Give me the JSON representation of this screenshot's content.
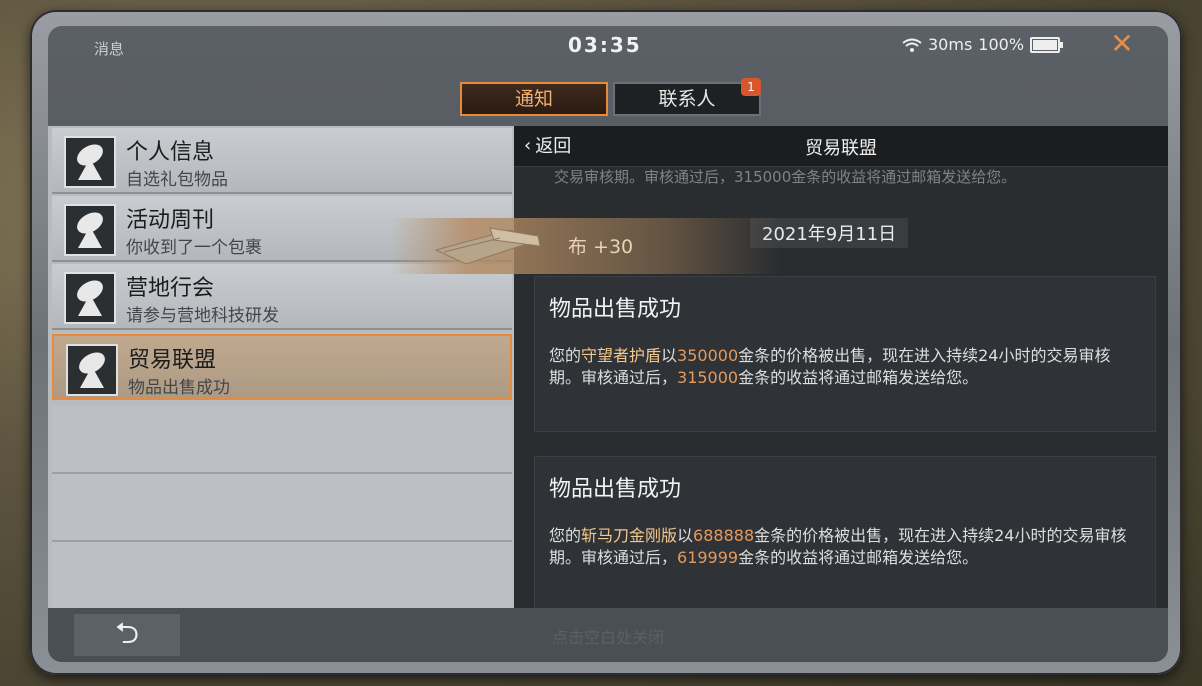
{
  "status": {
    "title": "消息",
    "clock": "03:35",
    "ping": "30ms",
    "battery": "100%"
  },
  "tabs": [
    {
      "label": "通知",
      "active": true
    },
    {
      "label": "联系人",
      "badge": "1"
    }
  ],
  "list": [
    {
      "name": "个人信息",
      "sub": "自选礼包物品"
    },
    {
      "name": "活动周刊",
      "sub": "你收到了一个包裹"
    },
    {
      "name": "营地行会",
      "sub": "请参与营地科技研发"
    },
    {
      "name": "贸易联盟",
      "sub": "物品出售成功",
      "selected": true
    }
  ],
  "panel": {
    "back_label": "返回",
    "title": "贸易联盟",
    "cut_text": "交易审核期。审核通过后，315000金条的收益将通过邮箱发送给您。",
    "date": "2021年9月11日",
    "messages": [
      {
        "title": "物品出售成功",
        "pre": "您的",
        "item": "守望者护盾",
        "mid1": "以",
        "price": "350000",
        "mid2": "金条的价格被出售，现在进入持续24小时的交易审核期。审核通过后，",
        "income": "315000",
        "post": "金条的收益将通过邮箱发送给您。"
      },
      {
        "title": "物品出售成功",
        "pre": "您的",
        "item": "斩马刀金刚版",
        "mid1": "以",
        "price": "688888",
        "mid2": "金条的价格被出售，现在进入持续24小时的交易审核期。审核通过后，",
        "income": "619999",
        "post": "金条的收益将通过邮箱发送给您。"
      }
    ]
  },
  "toast": {
    "text": "布 +30"
  },
  "bottom": {
    "hint": "点击空白处关闭",
    "undo_icon": "undo-icon"
  },
  "colors": {
    "accent": "#e78a3c",
    "highlight_item": "#f3c88c",
    "highlight_number": "#e59a59"
  }
}
